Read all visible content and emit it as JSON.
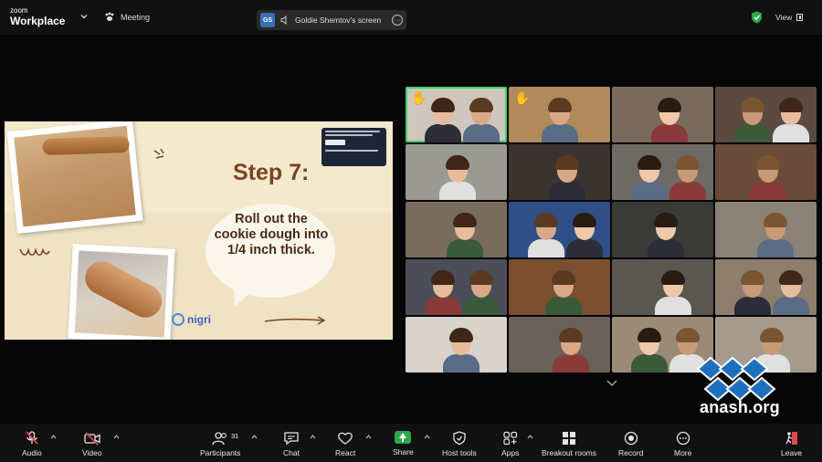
{
  "app": {
    "brand_line1": "zoom",
    "brand_line2": "Workplace",
    "meeting_label": "Meeting"
  },
  "share": {
    "initials": "GS",
    "label": "Goldie Shemtov's screen"
  },
  "header": {
    "view_label": "View"
  },
  "slide": {
    "step_title": "Step 7:",
    "instruction": "Roll out the cookie dough into 1/4 inch thick.",
    "logo_text": "nigri"
  },
  "gallery": {
    "tiles": [
      {
        "bg": "#cfc6bd",
        "hand": true,
        "active": true
      },
      {
        "bg": "#b08a5a",
        "hand": true
      },
      {
        "bg": "#7a6a5e"
      },
      {
        "bg": "#5b4a42"
      },
      {
        "bg": "#9a9a92"
      },
      {
        "bg": "#3a3330"
      },
      {
        "bg": "#6d6a63"
      },
      {
        "bg": "#6a4b3a"
      },
      {
        "bg": "#786c5e"
      },
      {
        "bg": "#2f4f86"
      },
      {
        "bg": "#3a3a36"
      },
      {
        "bg": "#8a8277"
      },
      {
        "bg": "#4b4e58"
      },
      {
        "bg": "#7a4e2e"
      },
      {
        "bg": "#5a5650"
      },
      {
        "bg": "#8e7e6e"
      },
      {
        "bg": "#d8d4cc"
      },
      {
        "bg": "#6a625a"
      },
      {
        "bg": "#9b8a76"
      },
      {
        "bg": "#a59a8c"
      }
    ]
  },
  "watermark": {
    "text": "anash.org"
  },
  "toolbar": {
    "audio": "Audio",
    "video": "Video",
    "participants": "Participants",
    "participants_count": "31",
    "chat": "Chat",
    "react": "React",
    "share": "Share",
    "host_tools": "Host tools",
    "apps": "Apps",
    "breakout": "Breakout rooms",
    "record": "Record",
    "more": "More",
    "leave": "Leave"
  },
  "colors": {
    "accent_green": "#2ca84c",
    "mute_red": "#e0484b",
    "leave_red": "#e0484b"
  }
}
